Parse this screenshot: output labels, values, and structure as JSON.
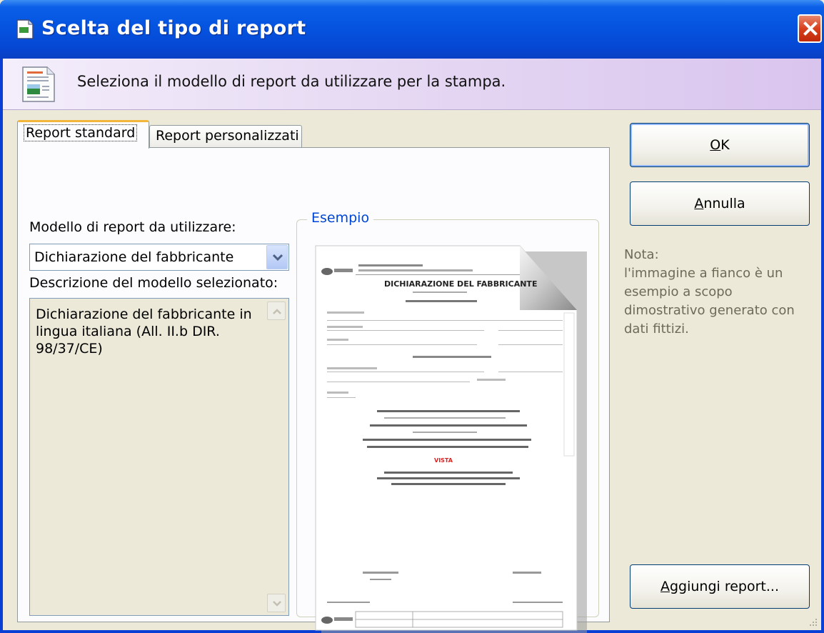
{
  "window": {
    "title": "Scelta del tipo di report",
    "header_text": "Seleziona il modello di report da utilizzare per la stampa."
  },
  "tabs": [
    {
      "label": "Report standard",
      "active": true
    },
    {
      "label": "Report personalizzati",
      "active": false
    }
  ],
  "panel": {
    "model_label": "Modello di report da utilizzare:",
    "model_value": "Dichiarazione del fabbricante",
    "description_label": "Descrizione del modello selezionato:",
    "description_text": "Dichiarazione del fabbricante in lingua italiana (All. II.b DIR. 98/37/CE)",
    "example_legend": "Esempio"
  },
  "preview_doc": {
    "heading": "DICHIARAZIONE DEL FABBRICANTE",
    "stamp": "VISTA"
  },
  "buttons": {
    "ok": {
      "mnemonic": "O",
      "rest": "K"
    },
    "cancel": {
      "mnemonic": "A",
      "rest": "nnulla"
    },
    "add": {
      "mnemonic": "A",
      "rest": "ggiungi report..."
    }
  },
  "note": {
    "title": "Nota:",
    "text": "l'immagine a fianco è un esempio a scopo dimostrativo generato con dati fittizi."
  },
  "colors": {
    "title_bar": "#0554e0",
    "header_band": "#e8dcf4",
    "legend_text": "#0046d5",
    "note_text": "#6e6a58",
    "stamp_red": "#e02020"
  }
}
